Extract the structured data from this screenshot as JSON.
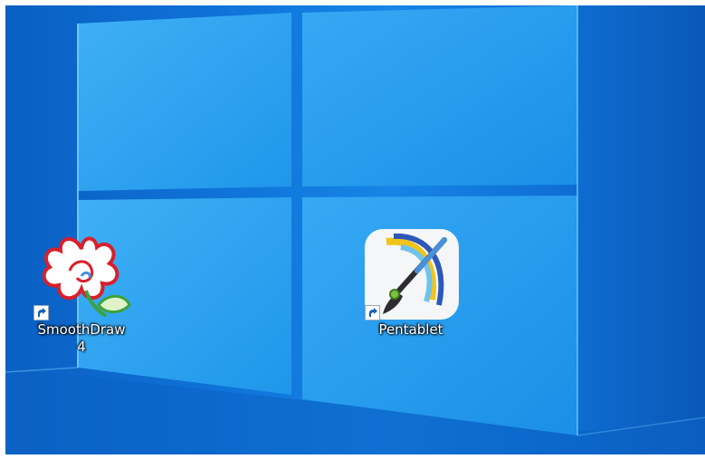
{
  "desktop": {
    "icons": [
      {
        "name": "SmoothDraw 4",
        "label_line1": "SmoothDraw",
        "label_line2": "4",
        "icon": "smoothdraw-flower-icon",
        "shortcut": true
      },
      {
        "name": "Pentablet",
        "label_line1": "Pentablet",
        "icon": "pentablet-brush-icon",
        "shortcut": true
      }
    ]
  },
  "colors": {
    "wallpaper_dark": "#0a5fc2",
    "wallpaper_light": "#1585e6",
    "label_text": "#ffffff"
  }
}
